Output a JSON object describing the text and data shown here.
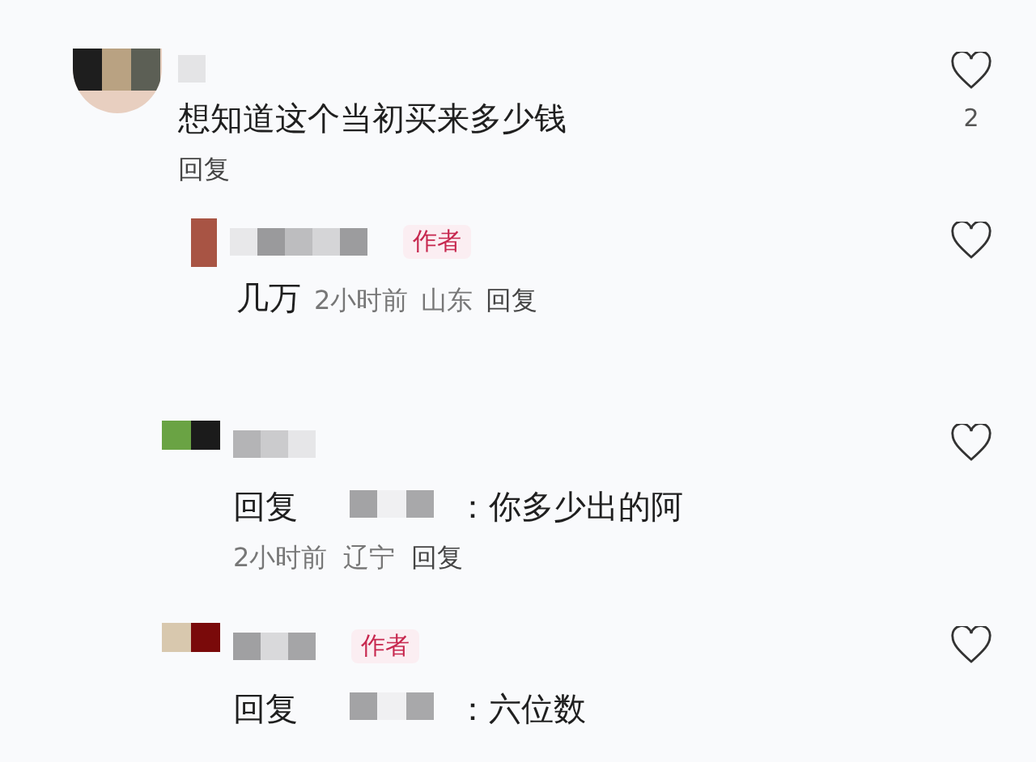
{
  "comments": [
    {
      "kind": "top",
      "text": "想知道这个当初买来多少钱",
      "meta": [
        "回复"
      ],
      "likes": "2"
    },
    {
      "kind": "reply",
      "badge": "作者",
      "text": "几万",
      "meta": [
        "2小时前",
        "山东",
        "回复"
      ]
    },
    {
      "kind": "nested",
      "prefix": "回复",
      "text": "：你多少出的阿",
      "meta": [
        "2小时前",
        "辽宁",
        "回复"
      ]
    },
    {
      "kind": "nested",
      "badge": "作者",
      "prefix": "回复",
      "text": "：六位数"
    }
  ]
}
